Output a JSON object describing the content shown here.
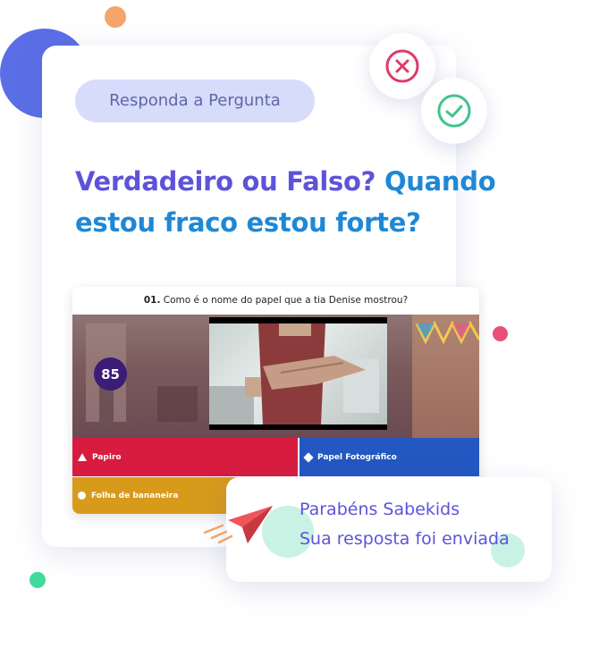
{
  "prompt_pill": "Responda a Pergunta",
  "question": {
    "part1": "Verdadeiro ou Falso?",
    "part2": "Quando estou fraco estou forte?"
  },
  "quiz": {
    "number": "01.",
    "question": "Como é o nome do papel que a tia Denise mostrou?",
    "timer": "85",
    "answers": [
      {
        "label": "Papiro",
        "shape": "triangle",
        "color": "#d71c3f"
      },
      {
        "label": "Papel Fotográfico",
        "shape": "diamond",
        "color": "#2357c1"
      },
      {
        "label": "Folha de bananeira",
        "shape": "circle",
        "color": "#d79a1b"
      }
    ]
  },
  "success": {
    "line1": "Parabéns Sabekids",
    "line2": "Sua resposta foi enviada"
  },
  "icons": {
    "wrong": "x-circle-icon",
    "right": "check-circle-icon",
    "send": "paper-plane-icon"
  },
  "colors": {
    "accent_purple": "#5d53da",
    "accent_blue": "#1e88d6",
    "wrong": "#e0386a",
    "right": "#3fc48c"
  }
}
